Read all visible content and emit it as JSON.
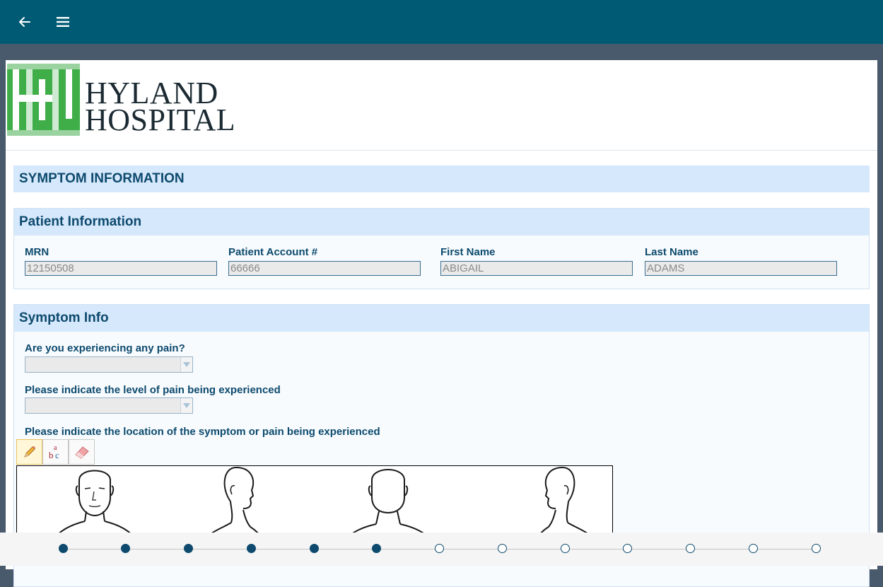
{
  "appbar": {
    "back_icon": "arrow-left-icon",
    "menu_icon": "hamburger-menu-icon",
    "color": "#005a73"
  },
  "logo": {
    "line1": "HYLAND",
    "line2": "HOSPITAL",
    "mark_color": "#3fae49"
  },
  "form": {
    "title": "SYMPTOM INFORMATION",
    "patient_section": {
      "title": "Patient Information",
      "fields": [
        {
          "label": "MRN",
          "value": "12150508"
        },
        {
          "label": "Patient Account #",
          "value": "66666"
        },
        {
          "label": "First Name",
          "value": "ABIGAIL"
        },
        {
          "label": "Last Name",
          "value": "ADAMS"
        }
      ]
    },
    "symptom_section": {
      "title": "Symptom Info",
      "pain_question": "Are you experiencing any pain?",
      "pain_value": "",
      "level_question": "Please indicate the level of pain being experienced",
      "level_value": "",
      "location_question": "Please indicate the location of the symptom or pain being experienced",
      "tools": [
        {
          "name": "pencil-icon",
          "active": true
        },
        {
          "name": "text-abc-icon",
          "active": false
        },
        {
          "name": "eraser-icon",
          "active": false
        }
      ],
      "canvas_icons": [
        "head-front-icon",
        "head-right-side-icon",
        "head-back-icon",
        "head-left-side-icon"
      ]
    }
  },
  "stepper": {
    "total_steps": 13,
    "completed_steps": 6,
    "accent": "#0d4a6e"
  }
}
